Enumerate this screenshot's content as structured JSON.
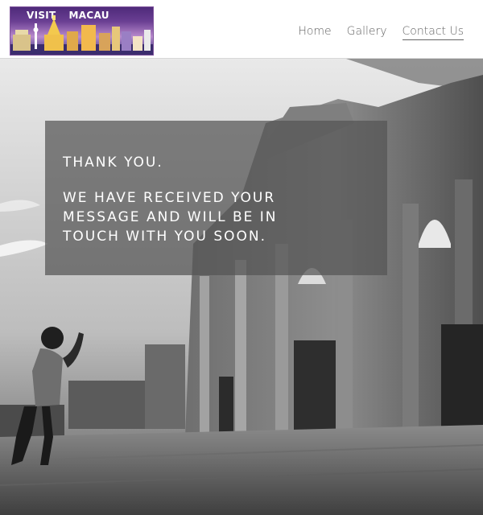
{
  "header": {
    "logo": {
      "text_part1": "VISIT",
      "text_part2": "MACAU"
    },
    "nav": [
      {
        "label": "Home",
        "active": false
      },
      {
        "label": "Gallery",
        "active": false
      },
      {
        "label": "Contact Us",
        "active": true
      }
    ]
  },
  "message": {
    "heading": "THANK YOU.",
    "body_lines": [
      "WE HAVE RECEIVED YOUR",
      "MESSAGE AND WILL BE IN",
      "TOUCH WITH YOU SOON."
    ]
  },
  "colors": {
    "nav_text": "#646464",
    "overlay": "rgba(85,85,85,0.72)",
    "logo_bg": "#4e2a7a"
  }
}
